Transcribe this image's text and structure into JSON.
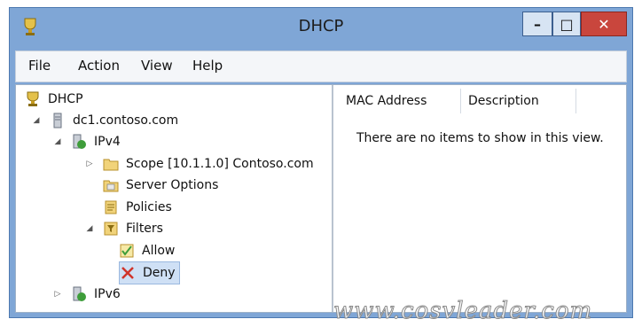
{
  "window": {
    "title": "DHCP",
    "controls": {
      "minimize": "–",
      "maximize": "□",
      "close": "✕"
    }
  },
  "menu": [
    "File",
    "Action",
    "View",
    "Help"
  ],
  "tree": {
    "root": "DHCP",
    "server": "dc1.contoso.com",
    "ipv4": "IPv4",
    "scope": "Scope [10.1.1.0] Contoso.com",
    "server_options": "Server Options",
    "policies": "Policies",
    "filters": "Filters",
    "allow": "Allow",
    "deny": "Deny",
    "ipv6": "IPv6"
  },
  "list": {
    "columns": [
      "MAC Address",
      "Description"
    ],
    "empty_message": "There are no items to show in this view."
  },
  "watermark": "www.cosvleader.com",
  "colors": {
    "titlebar": "#7fa6d6",
    "close_button": "#c9463d",
    "selection": "#cfe0f5"
  }
}
